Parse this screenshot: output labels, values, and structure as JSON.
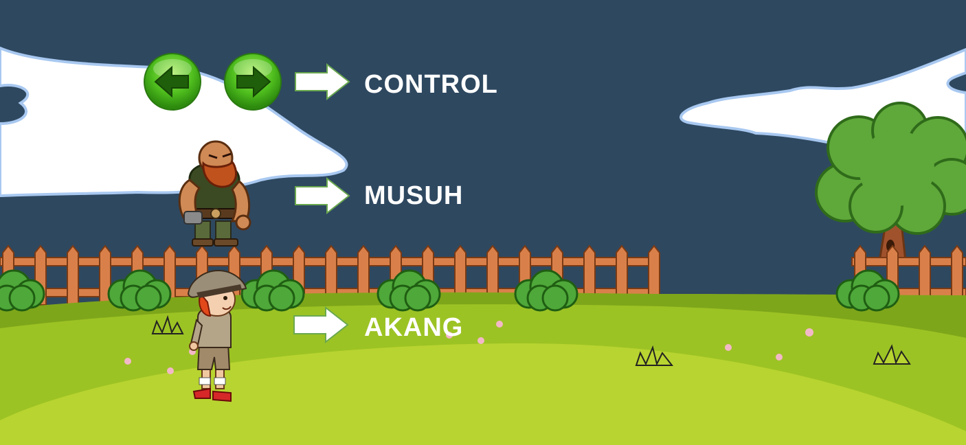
{
  "legend": {
    "control_label": "CONTROL",
    "enemy_label": "MUSUH",
    "player_label": "AKANG"
  },
  "controls": {
    "left_icon": "arrow-left-icon",
    "right_icon": "arrow-right-icon"
  },
  "colors": {
    "sky": "#2e4860",
    "cloud": "#ffffff",
    "cloud_outline": "#a8c8f0",
    "grass_light": "#b8d430",
    "grass_mid": "#9cc324",
    "grass_dark": "#7ea61a",
    "fence": "#d9804a",
    "button_green": "#4fbe1e",
    "label_text": "#ffffff"
  }
}
